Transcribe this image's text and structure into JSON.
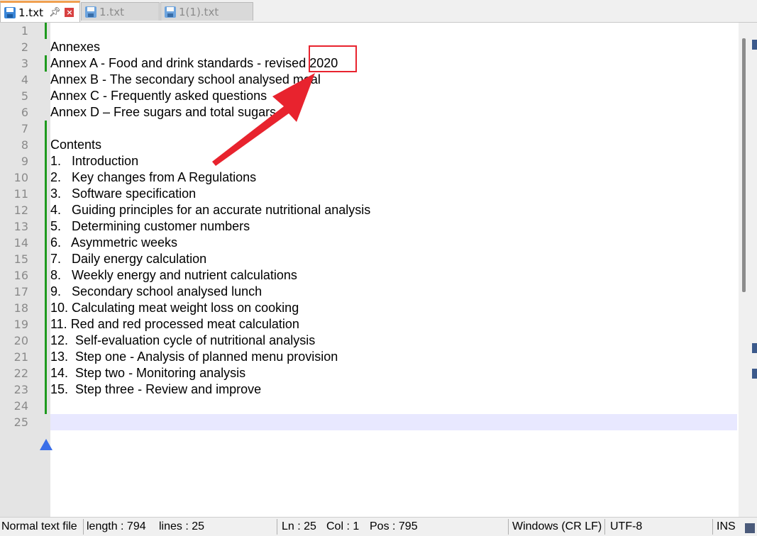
{
  "tabs": [
    {
      "label": "1.txt",
      "active": true,
      "pin_icon": "pin-icon",
      "close_icon": "close-icon"
    },
    {
      "label": "1.txt",
      "active": false
    },
    {
      "label": "1(1).txt",
      "active": false
    }
  ],
  "editor": {
    "lines": [
      "",
      "Annexes",
      "Annex A - Food and drink standards - revised 2020",
      "Annex B - The secondary school analysed meal",
      "Annex C - Frequently asked questions",
      "Annex D – Free sugars and total sugars",
      "",
      "Contents",
      "1.   Introduction",
      "2.   Key changes from A Regulations",
      "3.   Software specification",
      "4.   Guiding principles for an accurate nutritional analysis",
      "5.   Determining customer numbers",
      "6.   Asymmetric weeks",
      "7.   Daily energy calculation",
      "8.   Weekly energy and nutrient calculations",
      "9.   Secondary school analysed lunch",
      "10. Calculating meat weight loss on cooking",
      "11. Red and red processed meat calculation",
      "12.  Self-evaluation cycle of nutritional analysis",
      "13.  Step one - Analysis of planned menu provision",
      "14.  Step two - Monitoring analysis",
      "15.  Step three - Review and improve",
      "",
      ""
    ],
    "line_numbers": [
      "1",
      "2",
      "3",
      "4",
      "5",
      "6",
      "7",
      "8",
      "9",
      "10",
      "11",
      "12",
      "13",
      "14",
      "15",
      "16",
      "17",
      "18",
      "19",
      "20",
      "21",
      "22",
      "23",
      "24",
      "25"
    ],
    "current_line": 25,
    "annotation": {
      "highlight_color": "#e8232e"
    }
  },
  "statusbar": {
    "doc_type": "Normal text file",
    "length": "length : 794",
    "lines": "lines : 25",
    "ln": "Ln : 25",
    "col": "Col : 1",
    "pos": "Pos : 795",
    "eol": "Windows (CR LF)",
    "encoding": "UTF-8",
    "mode": "INS"
  },
  "colors": {
    "modified_bar": "#1e9a1e",
    "caret_line": "#e8e8ff",
    "active_tab_accent": "#f0a050"
  }
}
